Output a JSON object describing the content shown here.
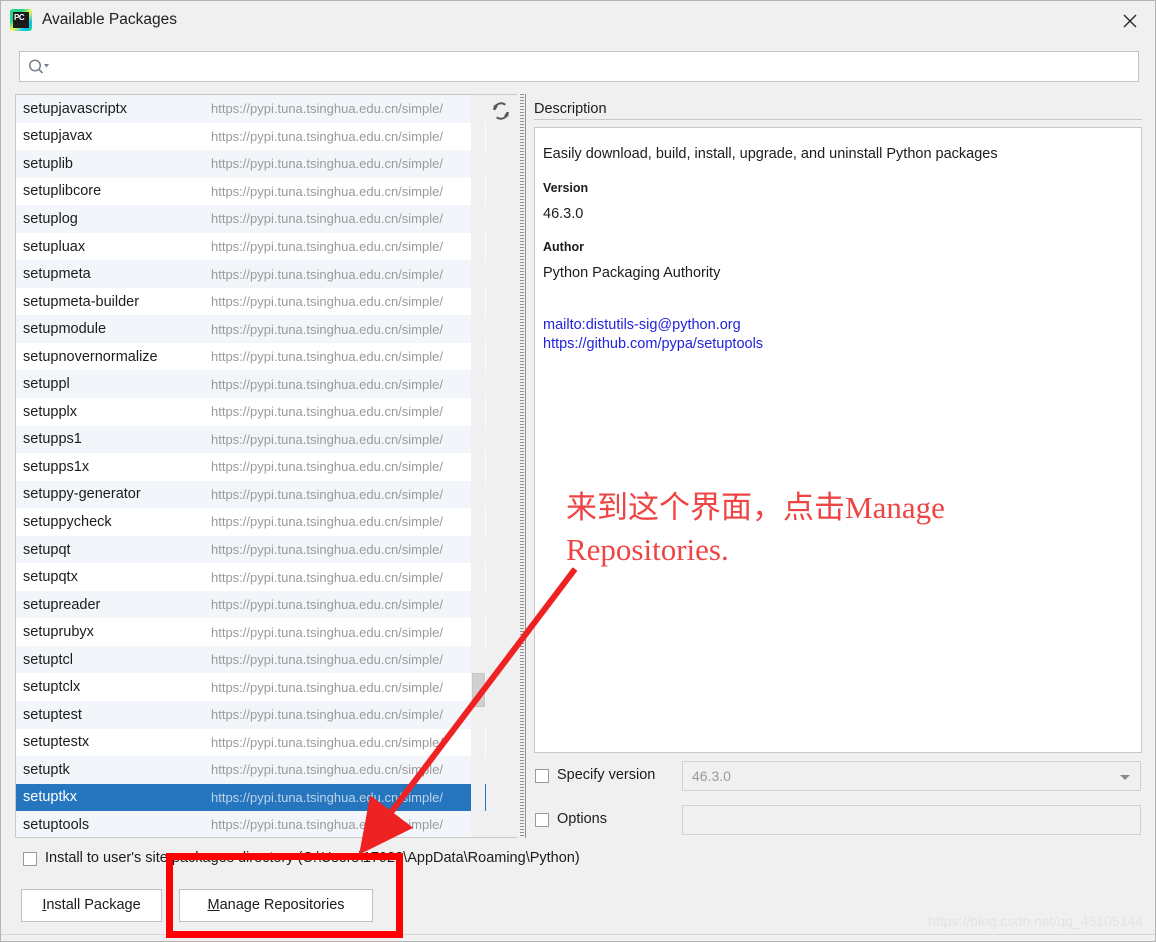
{
  "window": {
    "title": "Available Packages",
    "app_icon": "pycharm-icon",
    "close_icon": "close-icon"
  },
  "search": {
    "icon": "search-icon",
    "value": "",
    "placeholder": ""
  },
  "list": {
    "refresh_icon": "refresh-icon",
    "selected_index": 25,
    "repo_url": "https://pypi.tuna.tsinghua.edu.cn/simple/",
    "packages": [
      {
        "name": "setupjavascriptx",
        "url": "https://pypi.tuna.tsinghua.edu.cn/simple/"
      },
      {
        "name": "setupjavax",
        "url": "https://pypi.tuna.tsinghua.edu.cn/simple/"
      },
      {
        "name": "setuplib",
        "url": "https://pypi.tuna.tsinghua.edu.cn/simple/"
      },
      {
        "name": "setuplibcore",
        "url": "https://pypi.tuna.tsinghua.edu.cn/simple/"
      },
      {
        "name": "setuplog",
        "url": "https://pypi.tuna.tsinghua.edu.cn/simple/"
      },
      {
        "name": "setupluax",
        "url": "https://pypi.tuna.tsinghua.edu.cn/simple/"
      },
      {
        "name": "setupmeta",
        "url": "https://pypi.tuna.tsinghua.edu.cn/simple/"
      },
      {
        "name": "setupmeta-builder",
        "url": "https://pypi.tuna.tsinghua.edu.cn/simple/"
      },
      {
        "name": "setupmodule",
        "url": "https://pypi.tuna.tsinghua.edu.cn/simple/"
      },
      {
        "name": "setupnovernormalize",
        "url": "https://pypi.tuna.tsinghua.edu.cn/simple/"
      },
      {
        "name": "setuppl",
        "url": "https://pypi.tuna.tsinghua.edu.cn/simple/"
      },
      {
        "name": "setupplx",
        "url": "https://pypi.tuna.tsinghua.edu.cn/simple/"
      },
      {
        "name": "setupps1",
        "url": "https://pypi.tuna.tsinghua.edu.cn/simple/"
      },
      {
        "name": "setupps1x",
        "url": "https://pypi.tuna.tsinghua.edu.cn/simple/"
      },
      {
        "name": "setuppy-generator",
        "url": "https://pypi.tuna.tsinghua.edu.cn/simple/"
      },
      {
        "name": "setuppycheck",
        "url": "https://pypi.tuna.tsinghua.edu.cn/simple/"
      },
      {
        "name": "setupqt",
        "url": "https://pypi.tuna.tsinghua.edu.cn/simple/"
      },
      {
        "name": "setupqtx",
        "url": "https://pypi.tuna.tsinghua.edu.cn/simple/"
      },
      {
        "name": "setupreader",
        "url": "https://pypi.tuna.tsinghua.edu.cn/simple/"
      },
      {
        "name": "setuprubyx",
        "url": "https://pypi.tuna.tsinghua.edu.cn/simple/"
      },
      {
        "name": "setuptcl",
        "url": "https://pypi.tuna.tsinghua.edu.cn/simple/"
      },
      {
        "name": "setuptclx",
        "url": "https://pypi.tuna.tsinghua.edu.cn/simple/"
      },
      {
        "name": "setuptest",
        "url": "https://pypi.tuna.tsinghua.edu.cn/simple/"
      },
      {
        "name": "setuptestx",
        "url": "https://pypi.tuna.tsinghua.edu.cn/simple/"
      },
      {
        "name": "setuptk",
        "url": "https://pypi.tuna.tsinghua.edu.cn/simple/"
      },
      {
        "name": "setuptkx",
        "url": "https://pypi.tuna.tsinghua.edu.cn/simple/"
      },
      {
        "name": "setuptools",
        "url": "https://pypi.tuna.tsinghua.edu.cn/simple/"
      }
    ]
  },
  "description": {
    "section_label": "Description",
    "summary": "Easily download, build, install, upgrade, and uninstall Python packages",
    "version_label": "Version",
    "version_value": "46.3.0",
    "author_label": "Author",
    "author_value": "Python Packaging Authority",
    "links": [
      "mailto:distutils-sig@python.org",
      "https://github.com/pypa/setuptools"
    ]
  },
  "options": {
    "specify_version_label": "Specify version",
    "specify_version_checked": false,
    "version_selected": "46.3.0",
    "options_label": "Options",
    "options_checked": false,
    "options_value": ""
  },
  "footer": {
    "user_site_label": "Install to user's site packages directory (C:\\Users\\17922\\AppData\\Roaming\\Python)",
    "user_site_checked": false,
    "install_button": "Install Package",
    "install_button_mnemonic": "I",
    "manage_button": "Manage Repositories",
    "manage_button_mnemonic": "M"
  },
  "annotation": {
    "text": "来到这个界面，点击Manage\nRepositories.",
    "color": "#ee4444",
    "box_color": "#ff0000",
    "arrow_color": "#ee2222"
  },
  "watermark": "https://blog.csdn.net/qq_45105144",
  "colors": {
    "selection": "#2675bf",
    "row_alt": "#f2f5f9",
    "link": "#2222dd",
    "chrome": "#f0f0f0"
  }
}
